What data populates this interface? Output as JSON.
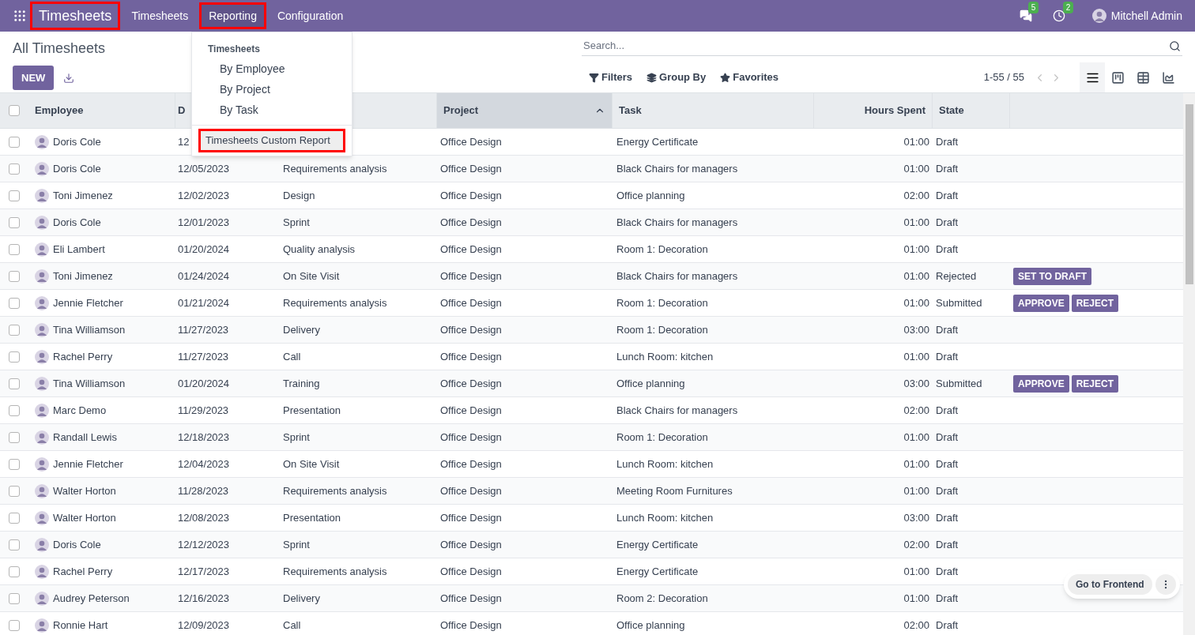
{
  "navbar": {
    "app_name": {
      "label": "Timesheets",
      "highlighted": true
    },
    "menu": [
      {
        "label": "Timesheets",
        "selected": false,
        "highlighted": false
      },
      {
        "label": "Reporting",
        "selected": true,
        "highlighted": true
      },
      {
        "label": "Configuration",
        "selected": false,
        "highlighted": false
      }
    ],
    "messages_count": "5",
    "activities_count": "2",
    "user": "Mitchell Admin"
  },
  "dropdown": {
    "section": "Timesheets",
    "items": [
      {
        "label": "By Employee",
        "kind": "sub",
        "highlighted": false
      },
      {
        "label": "By Project",
        "kind": "sub",
        "highlighted": false
      },
      {
        "label": "By Task",
        "kind": "sub",
        "highlighted": false
      },
      {
        "label": "Timesheets Custom Report",
        "kind": "report",
        "highlighted": true
      }
    ]
  },
  "breadcrumb": "All Timesheets",
  "new_button": "NEW",
  "search": {
    "placeholder": "Search..."
  },
  "filters": [
    {
      "label": "Filters",
      "kind": "filter"
    },
    {
      "label": "Group By",
      "kind": "group"
    },
    {
      "label": "Favorites",
      "kind": "favorite"
    }
  ],
  "pager": "1-55 / 55",
  "views": [
    {
      "kind": "list",
      "selected": true
    },
    {
      "kind": "kanban",
      "selected": false
    },
    {
      "kind": "pivot",
      "selected": false
    },
    {
      "kind": "graph",
      "selected": false
    }
  ],
  "table": {
    "select_all": {
      "checked": false
    },
    "columns": [
      {
        "label": "Employee",
        "sorted": false
      },
      {
        "label": "D",
        "sorted": false
      },
      {
        "sorted": false
      },
      {
        "label": "Project",
        "sorted": true
      },
      {
        "label": "Task",
        "sorted": false
      },
      {
        "label": "Hours Spent",
        "sorted": false
      },
      {
        "label": "State",
        "sorted": false
      }
    ],
    "rows": [
      {
        "checked": false,
        "employee": "Doris Cole",
        "date": "12",
        "project": "Office Design",
        "task": "Energy Certificate",
        "hours": "01:00",
        "state": "Draft"
      },
      {
        "checked": false,
        "employee": "Doris Cole",
        "date": "12/05/2023",
        "description": "Requirements analysis",
        "project": "Office Design",
        "task": "Black Chairs for managers",
        "hours": "01:00",
        "state": "Draft"
      },
      {
        "checked": false,
        "employee": "Toni Jimenez",
        "date": "12/02/2023",
        "description": "Design",
        "project": "Office Design",
        "task": "Office planning",
        "hours": "02:00",
        "state": "Draft"
      },
      {
        "checked": false,
        "employee": "Doris Cole",
        "date": "12/01/2023",
        "description": "Sprint",
        "project": "Office Design",
        "task": "Black Chairs for managers",
        "hours": "01:00",
        "state": "Draft"
      },
      {
        "checked": false,
        "employee": "Eli Lambert",
        "date": "01/20/2024",
        "description": "Quality analysis",
        "project": "Office Design",
        "task": "Room 1: Decoration",
        "hours": "01:00",
        "state": "Draft"
      },
      {
        "checked": false,
        "employee": "Toni Jimenez",
        "date": "01/24/2024",
        "description": "On Site Visit",
        "project": "Office Design",
        "task": "Black Chairs for managers",
        "hours": "01:00",
        "state": "Rejected",
        "actions": [
          "SET TO DRAFT"
        ]
      },
      {
        "checked": false,
        "employee": "Jennie Fletcher",
        "date": "01/21/2024",
        "description": "Requirements analysis",
        "project": "Office Design",
        "task": "Room 1: Decoration",
        "hours": "01:00",
        "state": "Submitted",
        "actions": [
          "APPROVE",
          "REJECT"
        ]
      },
      {
        "checked": false,
        "employee": "Tina Williamson",
        "date": "11/27/2023",
        "description": "Delivery",
        "project": "Office Design",
        "task": "Room 1: Decoration",
        "hours": "03:00",
        "state": "Draft"
      },
      {
        "checked": false,
        "employee": "Rachel Perry",
        "date": "11/27/2023",
        "description": "Call",
        "project": "Office Design",
        "task": "Lunch Room: kitchen",
        "hours": "01:00",
        "state": "Draft"
      },
      {
        "checked": false,
        "employee": "Tina Williamson",
        "date": "01/20/2024",
        "description": "Training",
        "project": "Office Design",
        "task": "Office planning",
        "hours": "03:00",
        "state": "Submitted",
        "actions": [
          "APPROVE",
          "REJECT"
        ]
      },
      {
        "checked": false,
        "employee": "Marc Demo",
        "date": "11/29/2023",
        "description": "Presentation",
        "project": "Office Design",
        "task": "Black Chairs for managers",
        "hours": "02:00",
        "state": "Draft"
      },
      {
        "checked": false,
        "employee": "Randall Lewis",
        "date": "12/18/2023",
        "description": "Sprint",
        "project": "Office Design",
        "task": "Room 1: Decoration",
        "hours": "01:00",
        "state": "Draft"
      },
      {
        "checked": false,
        "employee": "Jennie Fletcher",
        "date": "12/04/2023",
        "description": "On Site Visit",
        "project": "Office Design",
        "task": "Lunch Room: kitchen",
        "hours": "01:00",
        "state": "Draft"
      },
      {
        "checked": false,
        "employee": "Walter Horton",
        "date": "11/28/2023",
        "description": "Requirements analysis",
        "project": "Office Design",
        "task": "Meeting Room Furnitures",
        "hours": "01:00",
        "state": "Draft"
      },
      {
        "checked": false,
        "employee": "Walter Horton",
        "date": "12/08/2023",
        "description": "Presentation",
        "project": "Office Design",
        "task": "Lunch Room: kitchen",
        "hours": "03:00",
        "state": "Draft"
      },
      {
        "checked": false,
        "employee": "Doris Cole",
        "date": "12/12/2023",
        "description": "Sprint",
        "project": "Office Design",
        "task": "Energy Certificate",
        "hours": "02:00",
        "state": "Draft"
      },
      {
        "checked": false,
        "employee": "Rachel Perry",
        "date": "12/17/2023",
        "description": "Requirements analysis",
        "project": "Office Design",
        "task": "Energy Certificate",
        "hours": "01:00",
        "state": "Draft"
      },
      {
        "checked": false,
        "employee": "Audrey Peterson",
        "date": "12/16/2023",
        "description": "Delivery",
        "project": "Office Design",
        "task": "Room 2: Decoration",
        "hours": "01:00",
        "state": "Draft"
      },
      {
        "checked": false,
        "employee": "Ronnie Hart",
        "date": "12/09/2023",
        "description": "Call",
        "project": "Office Design",
        "task": "Office planning",
        "hours": "02:00",
        "state": "Draft"
      }
    ]
  },
  "frontend_button": "Go to Frontend"
}
